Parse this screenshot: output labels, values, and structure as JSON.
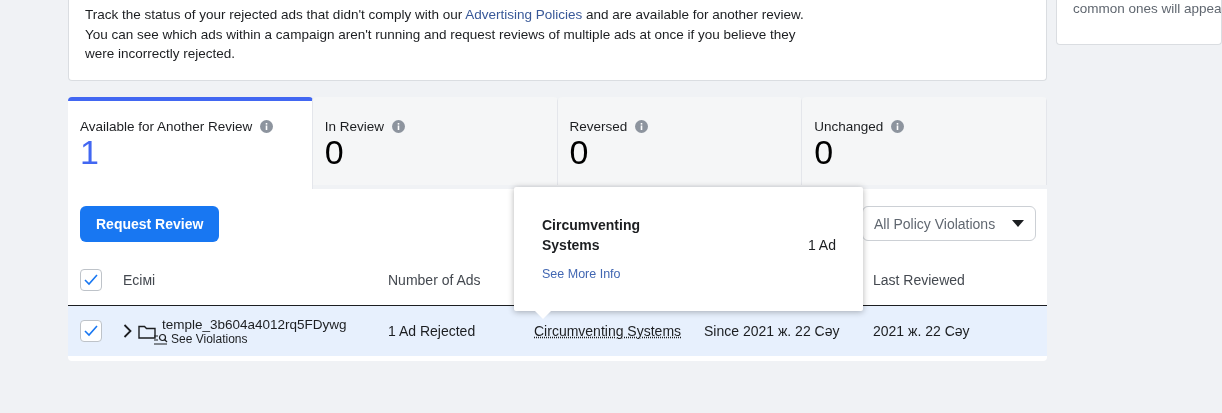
{
  "intro": {
    "text_before": "Track the status of your rejected ads that didn't comply with our ",
    "link": "Advertising Policies",
    "text_after": " and are available for another review.\nYou can see which ads within a campaign aren't running and request reviews of multiple ads at once if you believe they\nwere incorrectly rejected."
  },
  "side_card": {
    "text": "common ones will appea"
  },
  "tabs": [
    {
      "label": "Available for Another Review",
      "count": "1",
      "selected": true
    },
    {
      "label": "In Review",
      "count": "0",
      "selected": false
    },
    {
      "label": "Reversed",
      "count": "0",
      "selected": false
    },
    {
      "label": "Unchanged",
      "count": "0",
      "selected": false
    }
  ],
  "toolbar": {
    "button": "Request Review",
    "filter": "All Policy Violations"
  },
  "table": {
    "header_checked": true,
    "columns": [
      "Ecімі",
      "Number of Ads",
      "",
      "",
      "Last Reviewed"
    ],
    "rows": [
      {
        "checked": true,
        "selected": true,
        "name": "temple_3b604a4012rq5FDywg",
        "action": "See Violations",
        "ads": "1 Ad Rejected",
        "policy": "Circumventing Systems",
        "since": "Since 2021 ж. 22 Сәу",
        "last_reviewed": "2021 ж. 22 Сәу"
      }
    ]
  },
  "popover": {
    "title": "Circumventing Systems",
    "count": "1 Ad",
    "link": "See More Info"
  }
}
